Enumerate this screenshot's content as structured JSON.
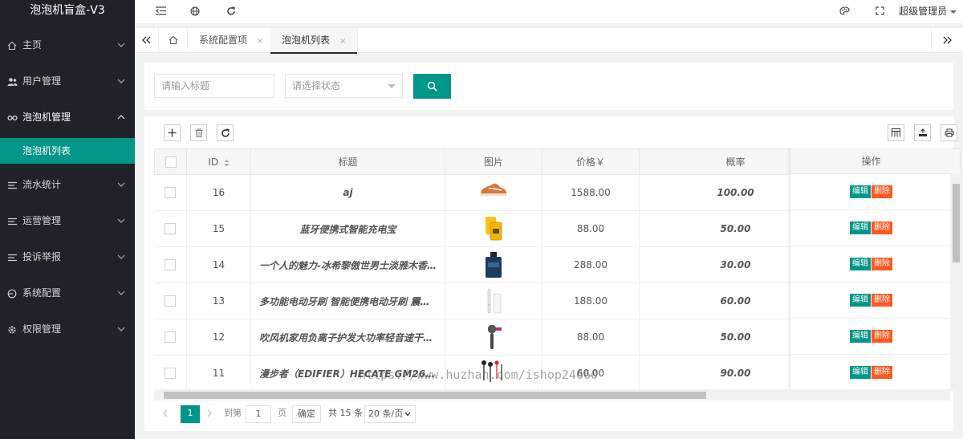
{
  "app": {
    "title": "泡泡机盲盒-V3"
  },
  "sidebar": {
    "items": [
      {
        "label": "主页",
        "icon": "home-icon"
      },
      {
        "label": "用户管理",
        "icon": "users-icon"
      },
      {
        "label": "泡泡机管理",
        "icon": "link-icon",
        "expanded": true
      },
      {
        "label": "流水统计",
        "icon": "list-icon"
      },
      {
        "label": "运营管理",
        "icon": "list-icon"
      },
      {
        "label": "投诉举报",
        "icon": "list-icon"
      },
      {
        "label": "系统配置",
        "icon": "settings-icon"
      },
      {
        "label": "权限管理",
        "icon": "gear-icon"
      }
    ],
    "sub_active": "泡泡机列表"
  },
  "header": {
    "user": "超级管理员"
  },
  "tabs": [
    {
      "label": "系统配置项",
      "close": "×"
    },
    {
      "label": "泡泡机列表",
      "close": "×",
      "active": true
    }
  ],
  "search": {
    "title_placeholder": "请输入标题",
    "status_placeholder": "请选择状态"
  },
  "table": {
    "columns": [
      "ID",
      "标题",
      "图片",
      "价格￥",
      "概率",
      "操作"
    ],
    "rows": [
      {
        "id": "16",
        "title": "aj",
        "image": "sneaker",
        "price": "1588.00",
        "rate": "100.00"
      },
      {
        "id": "15",
        "title": "蓝牙便携式智能充电宝",
        "image": "powerbank",
        "price": "88.00",
        "rate": "50.00"
      },
      {
        "id": "14",
        "title": "一个人的魅力-冰希黎傲世男士淡雅木香…",
        "image": "perfume",
        "price": "288.00",
        "rate": "30.00"
      },
      {
        "id": "13",
        "title": "多功能电动牙刷 智能便携电动牙刷 震动…",
        "image": "toothbrush",
        "price": "188.00",
        "rate": "60.00"
      },
      {
        "id": "12",
        "title": "吹风机家用负离子护发大功率轻音速干电…",
        "image": "hairdryer",
        "price": "88.00",
        "rate": "50.00"
      },
      {
        "id": "11",
        "title": "漫步者（EDIFIER）HECATE GM260入…",
        "image": "earphones",
        "price": "60.00",
        "rate": "90.00"
      }
    ],
    "edit_label": "编辑",
    "delete_label": "删除"
  },
  "pager": {
    "current_page": "1",
    "goto_label": "到第",
    "goto_value": "1",
    "page_unit": "页",
    "confirm_label": "确定",
    "total_label": "共 15 条",
    "page_size": "20 条/页"
  },
  "watermark": "https://www.huzhan.com/ishop24660",
  "colors": {
    "accent": "#009688",
    "danger": "#ff5722",
    "sidebar": "#20222a"
  }
}
